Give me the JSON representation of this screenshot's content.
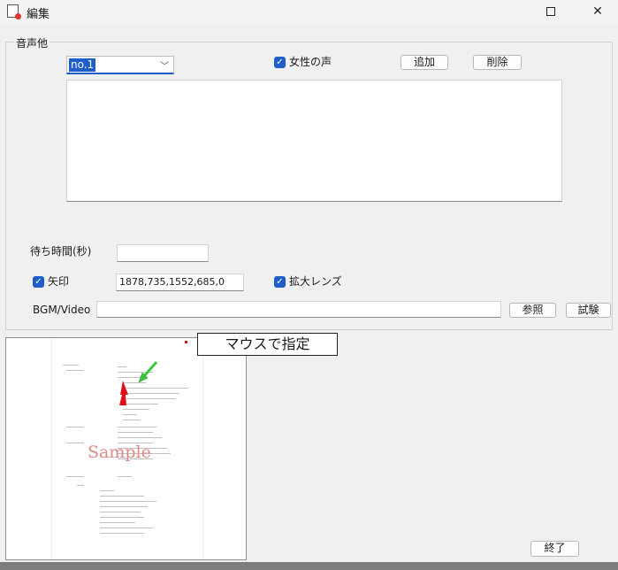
{
  "window": {
    "title": "編集",
    "maximize_icon": "maximize-icon",
    "close_symbol": "✕"
  },
  "group": {
    "legend": "音声他"
  },
  "voice_select": {
    "selected": "no.1",
    "arrow": "chevron-down-icon"
  },
  "female_voice": {
    "checked": true,
    "label": "女性の声"
  },
  "buttons": {
    "add": "追加",
    "delete": "削除",
    "browse": "参照",
    "test": "試験",
    "finish": "終了"
  },
  "wait_time": {
    "label": "待ち時間(秒)",
    "value": ""
  },
  "arrow_option": {
    "checked": true,
    "label": "矢印",
    "value": "1878,735,1552,685,0"
  },
  "magnifier_option": {
    "checked": true,
    "label": "拡大レンズ"
  },
  "bgm": {
    "label": "BGM/Video",
    "value": ""
  },
  "preview": {
    "callout_text": "マウスで指定",
    "watermark": "Sample"
  },
  "colors": {
    "accent": "#1f5ec9",
    "arrow_red": "#e0101a",
    "arrow_green": "#3cc83c",
    "watermark": "#e08888"
  }
}
